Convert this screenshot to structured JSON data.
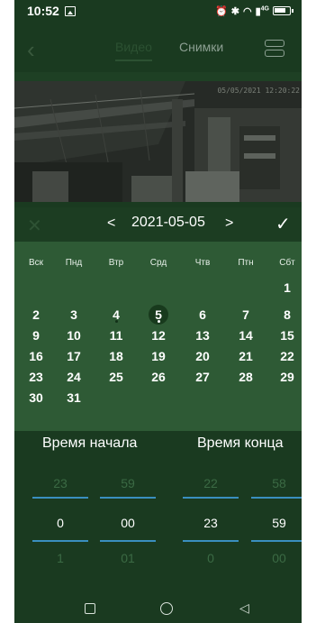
{
  "status_bar": {
    "time": "10:52",
    "network": "4G"
  },
  "header": {
    "tabs": [
      {
        "label": "Видео"
      },
      {
        "label": "Снимки"
      }
    ]
  },
  "video": {
    "timestamp": "05/05/2021 12:20:22"
  },
  "calendar": {
    "title": "2021-05-05",
    "weekdays": [
      "Вск",
      "Пнд",
      "Втр",
      "Срд",
      "Чтв",
      "Птн",
      "Сбт"
    ],
    "days": [
      "1",
      "2",
      "3",
      "4",
      "5",
      "6",
      "7",
      "8",
      "9",
      "10",
      "11",
      "12",
      "13",
      "14",
      "15",
      "16",
      "17",
      "18",
      "19",
      "20",
      "21",
      "22",
      "23",
      "24",
      "25",
      "26",
      "27",
      "28",
      "29",
      "30",
      "31"
    ],
    "selected_day": "5",
    "first_weekday_index": 6
  },
  "times": {
    "start_label": "Время начала",
    "end_label": "Время конца",
    "start_hour": {
      "prev": "23",
      "current": "0",
      "next": "1"
    },
    "start_minute": {
      "prev": "59",
      "current": "00",
      "next": "01"
    },
    "end_hour": {
      "prev": "22",
      "current": "23",
      "next": "0"
    },
    "end_minute": {
      "prev": "58",
      "current": "59",
      "next": "00"
    }
  },
  "colors": {
    "bg": "#1a3a20",
    "calendar_body": "#2e5a35",
    "picker_line": "#3a8fbf"
  }
}
